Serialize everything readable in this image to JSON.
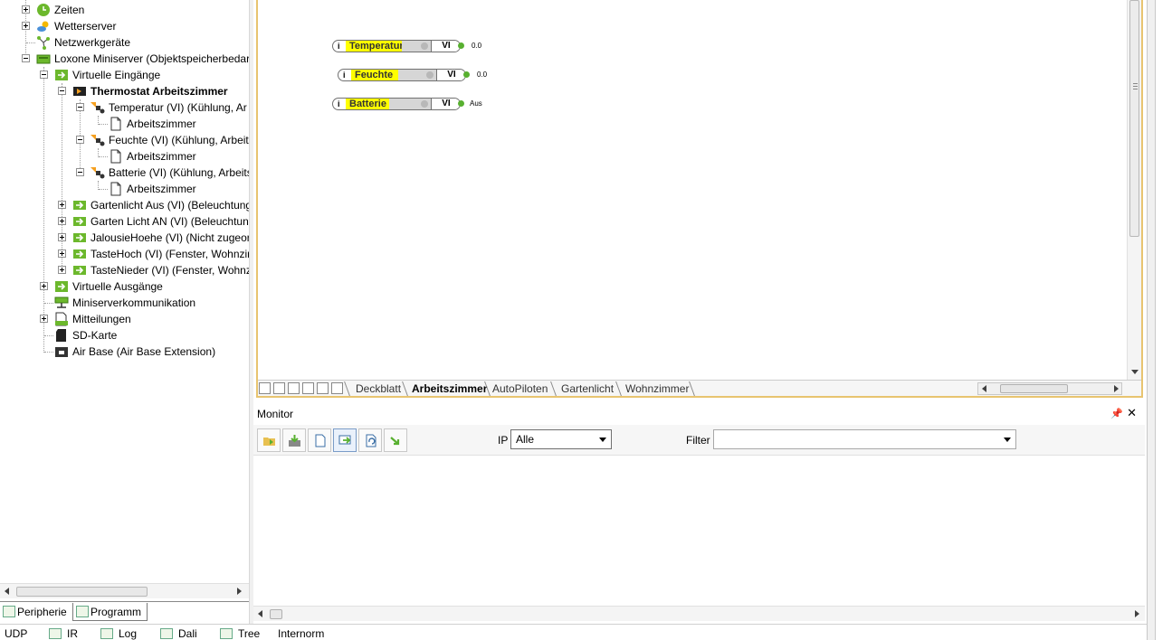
{
  "tree": {
    "items": [
      {
        "label": "Zeiten",
        "icon": "clock-icon",
        "bold": false
      },
      {
        "label": "Wetterserver",
        "icon": "weather-icon",
        "bold": false
      },
      {
        "label": "Netzwerkgeräte",
        "icon": "network-icon",
        "bold": false
      },
      {
        "label": "Loxone Miniserver (Objektspeicherbedar",
        "icon": "miniserver-icon",
        "bold": false
      },
      {
        "label": "Virtuelle Eingänge",
        "icon": "virtual-input-icon",
        "bold": false
      },
      {
        "label": "Thermostat Arbeitszimmer",
        "icon": "thermostat-icon",
        "bold": true
      },
      {
        "label": "Temperatur (VI) (Kühlung, Ar",
        "icon": "virtual-input-item-icon",
        "bold": false
      },
      {
        "label": "Arbeitszimmer",
        "icon": "page-icon",
        "bold": false
      },
      {
        "label": "Feuchte (VI) (Kühlung, Arbeit",
        "icon": "virtual-input-item-icon",
        "bold": false
      },
      {
        "label": "Arbeitszimmer",
        "icon": "page-icon",
        "bold": false
      },
      {
        "label": "Batterie (VI) (Kühlung, Arbeits",
        "icon": "virtual-input-item-icon",
        "bold": false
      },
      {
        "label": "Arbeitszimmer",
        "icon": "page-icon",
        "bold": false
      },
      {
        "label": "Gartenlicht Aus (VI) (Beleuchtung",
        "icon": "input-arrow-icon",
        "bold": false
      },
      {
        "label": "Garten Licht AN (VI) (Beleuchtun",
        "icon": "input-arrow-icon",
        "bold": false
      },
      {
        "label": "JalousieHoehe (VI) (Nicht zugeor",
        "icon": "input-arrow-icon",
        "bold": false
      },
      {
        "label": "TasteHoch (VI) (Fenster, Wohnzir",
        "icon": "input-arrow-icon",
        "bold": false
      },
      {
        "label": "TasteNieder (VI) (Fenster, Wohnz",
        "icon": "input-arrow-icon",
        "bold": false
      },
      {
        "label": "Virtuelle Ausgänge",
        "icon": "virtual-output-icon",
        "bold": false
      },
      {
        "label": "Miniserverkommunikation",
        "icon": "communication-icon",
        "bold": false
      },
      {
        "label": "Mitteilungen",
        "icon": "messages-icon",
        "bold": false
      },
      {
        "label": "SD-Karte",
        "icon": "sd-card-icon",
        "bold": false
      },
      {
        "label": "Air Base (Air Base Extension)",
        "icon": "air-base-icon",
        "bold": false
      }
    ]
  },
  "left_tabs": {
    "periphery": "Peripherie",
    "program": "Programm"
  },
  "canvas": {
    "blocks": [
      {
        "name": "Temperatur",
        "type": "VI",
        "value": "0.0"
      },
      {
        "name": "Feuchte",
        "type": "VI",
        "value": "0.0"
      },
      {
        "name": "Batterie",
        "type": "VI",
        "value": "Aus"
      }
    ],
    "tabs": [
      "Deckblatt",
      "Arbeitszimmer",
      "AutoPiloten",
      "Gartenlicht",
      "Wohnzimmer"
    ],
    "active_tab": "Arbeitszimmer"
  },
  "monitor": {
    "title": "Monitor",
    "ip_label": "IP",
    "ip_value": "Alle",
    "filter_label": "Filter",
    "filter_value": ""
  },
  "bottom_tabs": [
    "UDP",
    "IR",
    "Log",
    "Dali",
    "Tree",
    "Internorm"
  ],
  "colors": {
    "canvas_border": "#e8c470",
    "block_highlight": "#ffff00",
    "output_dot": "#58b030"
  }
}
